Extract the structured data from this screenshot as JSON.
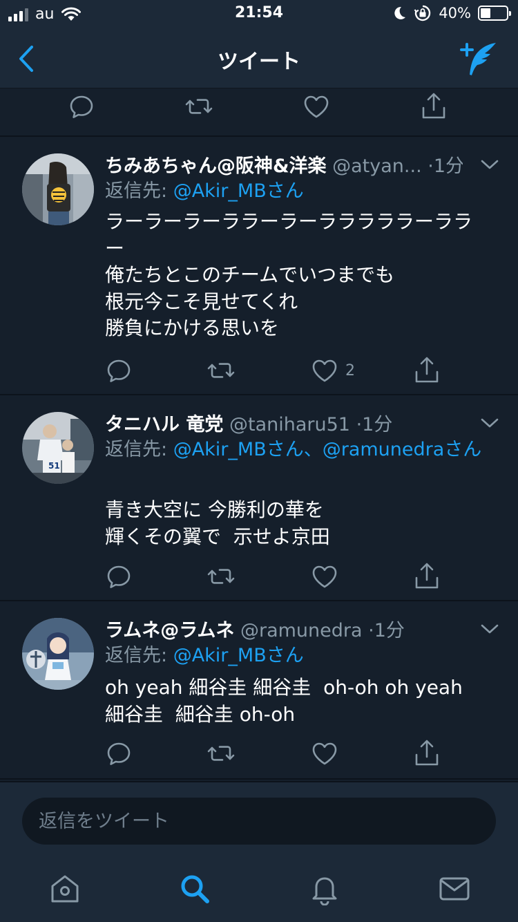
{
  "status_bar": {
    "carrier": "au",
    "time": "21:54",
    "battery_text": "40%",
    "battery_level": 0.4
  },
  "nav": {
    "title": "ツイート",
    "back_icon": "chevron-left-icon",
    "compose_icon": "compose-tweet-icon"
  },
  "tweets": [
    {
      "name": "ちみあちゃん@阪神&洋楽",
      "handle": "@atyan...",
      "time": "·1分",
      "reply_prefix": "返信先: ",
      "reply_mentions": "@Akir_MBさん",
      "body": "ラーラーラーララーラーラララララーララー\n俺たちとこのチームでいつまでも\n根元今こそ見せてくれ\n勝負にかける思いを",
      "like_count": "2"
    },
    {
      "name": "タニハル 竜党",
      "handle": "@taniharu51",
      "time": "·1分",
      "reply_prefix": "返信先: ",
      "reply_mentions": "@Akir_MBさん、@ramunedraさん",
      "body": "青き大空に 今勝利の華を\n輝くその翼で  示せよ京田",
      "like_count": ""
    },
    {
      "name": "ラムネ@ラムネ",
      "handle": "@ramunedra",
      "time": "·1分",
      "reply_prefix": "返信先: ",
      "reply_mentions": "@Akir_MBさん",
      "body": "oh yeah 細谷圭 細谷圭  oh-oh oh yeah\n細谷圭  細谷圭 oh-oh",
      "like_count": ""
    }
  ],
  "composer": {
    "placeholder": "返信をツイート"
  },
  "tab_bar": {
    "items": [
      "home-icon",
      "search-icon",
      "notifications-icon",
      "messages-icon"
    ],
    "active": "search-icon"
  },
  "colors": {
    "background": "#151F2B",
    "bar": "#1C2938",
    "accent": "#1DA1F2",
    "secondary_text": "#8899A6"
  }
}
